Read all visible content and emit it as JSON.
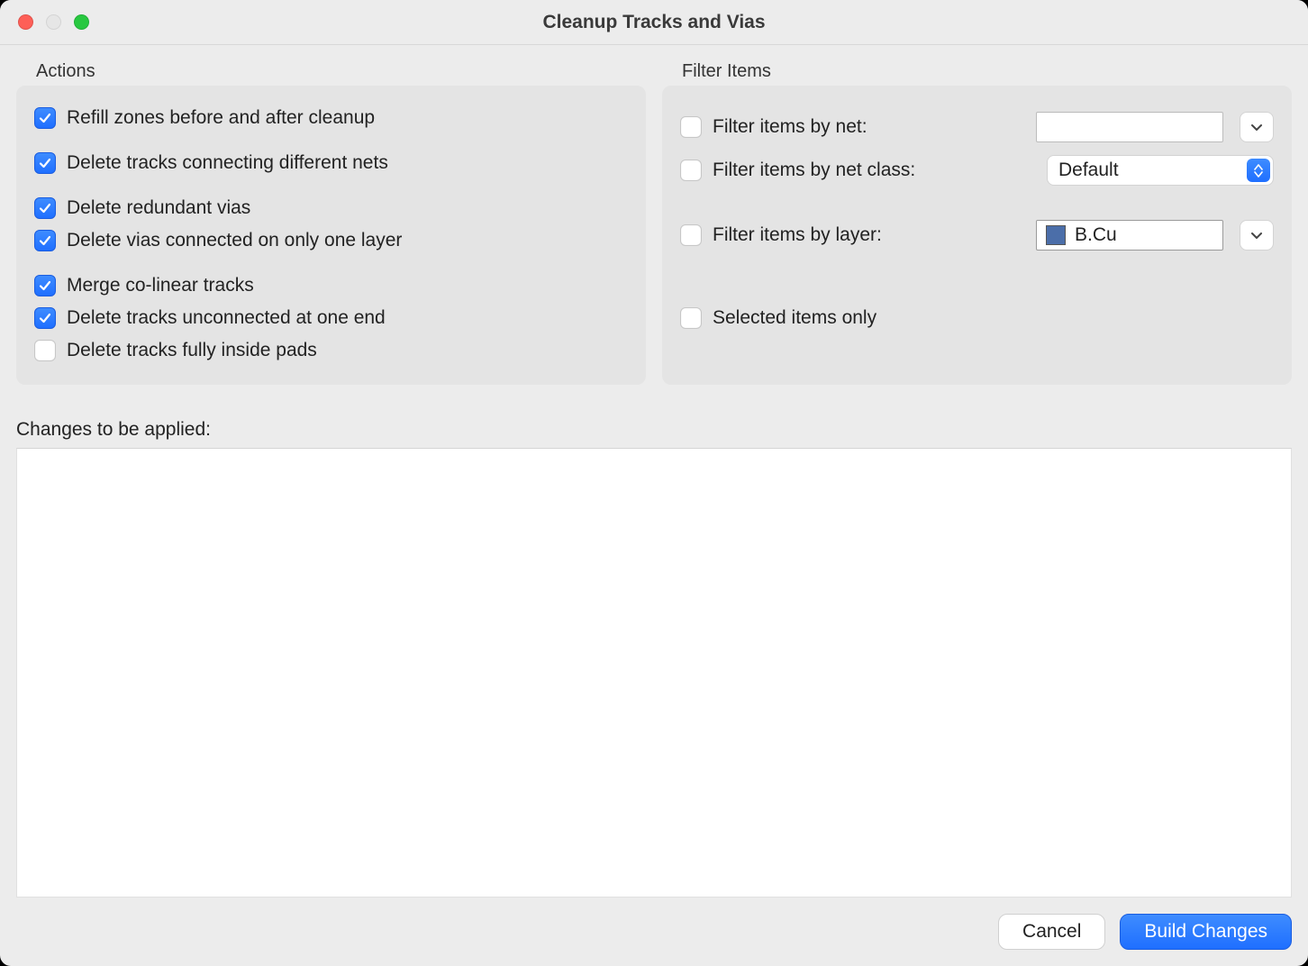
{
  "window": {
    "title": "Cleanup Tracks and Vias"
  },
  "actions": {
    "group_label": "Actions",
    "items": [
      {
        "label": "Refill zones before and after cleanup",
        "checked": true
      },
      {
        "label": "Delete tracks connecting different nets",
        "checked": true
      },
      {
        "label": "Delete redundant vias",
        "checked": true
      },
      {
        "label": "Delete vias connected on only one layer",
        "checked": true
      },
      {
        "label": "Merge co-linear tracks",
        "checked": true
      },
      {
        "label": "Delete tracks unconnected at one end",
        "checked": true
      },
      {
        "label": "Delete tracks fully inside pads",
        "checked": false
      }
    ]
  },
  "filters": {
    "group_label": "Filter Items",
    "by_net": {
      "label": "Filter items by net:",
      "checked": false,
      "value": ""
    },
    "by_netclass": {
      "label": "Filter items by net class:",
      "checked": false,
      "value": "Default"
    },
    "by_layer": {
      "label": "Filter items by layer:",
      "checked": false,
      "value": "B.Cu",
      "swatch": "#4b6ea9"
    },
    "selected_only": {
      "label": "Selected items only",
      "checked": false
    }
  },
  "changes": {
    "label": "Changes to be applied:"
  },
  "buttons": {
    "cancel": "Cancel",
    "primary": "Build Changes"
  }
}
